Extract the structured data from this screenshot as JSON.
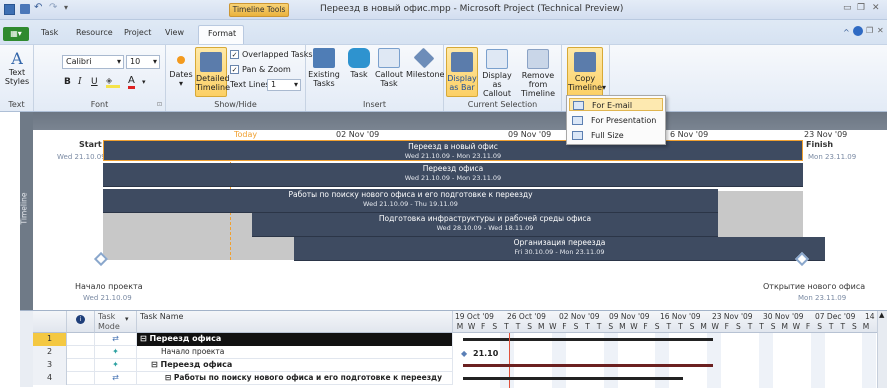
{
  "window": {
    "title": "Переезд в новый офис.mpp - Microsoft Project (Technical Preview)",
    "context_tab": "Timeline Tools"
  },
  "tabs": [
    "Task",
    "Resource",
    "Project",
    "View",
    "Format"
  ],
  "file_tab": "",
  "ribbon": {
    "text_styles": "Text\nStyles",
    "text_styles_l1": "Text",
    "text_styles_l2": "Styles",
    "font_name": "Calibri",
    "font_size": "10",
    "bold": "B",
    "italic": "I",
    "underline": "U",
    "group_text": "Text",
    "group_font": "Font",
    "dates": "Dates",
    "detailed_l1": "Detailed",
    "detailed_l2": "Timeline",
    "overlapped": "Overlapped Tasks",
    "pan_zoom": "Pan & Zoom",
    "text_lines_label": "Text Lines:",
    "text_lines_value": "1",
    "group_showhide": "Show/Hide",
    "existing_l1": "Existing",
    "existing_l2": "Tasks",
    "task": "Task",
    "callout_l1": "Callout",
    "callout_l2": "Task",
    "milestone": "Milestone",
    "group_insert": "Insert",
    "display_bar_l1": "Display",
    "display_bar_l2": "as Bar",
    "display_callout_l1": "Display",
    "display_callout_l2": "as Callout",
    "remove_l1": "Remove from",
    "remove_l2": "Timeline",
    "group_current": "Current Selection",
    "copy_l1": "Copy",
    "copy_l2": "Timeline"
  },
  "menu": {
    "items": [
      "For E-mail",
      "For Presentation",
      "Full Size"
    ]
  },
  "timeline": {
    "side_label": "Timeline",
    "today": "Today",
    "ticks": [
      "02 Nov '09",
      "09 Nov '09",
      "16 Nov '09",
      "23 Nov '09"
    ],
    "tick_partial": "6 Nov '09",
    "start_label": "Start",
    "start_date": "Wed 21.10.09",
    "finish_label": "Finish",
    "finish_date": "Mon 23.11.09",
    "bars": [
      {
        "name": "Переезд в новый офис",
        "dates": "Wed 21.10.09 - Mon 23.11.09"
      },
      {
        "name": "Переезд офиса",
        "dates": "Wed 21.10.09 - Mon 23.11.09"
      },
      {
        "name": "Работы по поиску нового офиса и его подготовке к переезду",
        "dates": "Wed 21.10.09 - Thu 19.11.09"
      },
      {
        "name": "Подготовка инфраструктуры и рабочей среды офиса",
        "dates": "Wed 28.10.09 - Wed 18.11.09"
      },
      {
        "name": "Организация переезда",
        "dates": "Fri 30.10.09 - Mon 23.11.09"
      }
    ],
    "milestones": [
      {
        "name": "Начало проекта",
        "date": "Wed 21.10.09"
      },
      {
        "name": "Открытие нового офиса",
        "date": "Mon 23.11.09"
      }
    ]
  },
  "grid": {
    "col_task_mode_l1": "Task",
    "col_task_mode_l2": "Mode",
    "col_task_name": "Task Name",
    "rows": [
      {
        "id": "1",
        "name": "Переезд офиса"
      },
      {
        "id": "2",
        "name": "Начало проекта"
      },
      {
        "id": "3",
        "name": "Переезд офиса"
      },
      {
        "id": "4",
        "name": "Работы по поиску нового офиса и его подготовке к переезду"
      }
    ],
    "gantt_weeks": [
      "19 Oct '09",
      "26 Oct '09",
      "02 Nov '09",
      "09 Nov '09",
      "16 Nov '09",
      "23 Nov '09",
      "30 Nov '09",
      "07 Dec '09",
      "14"
    ],
    "gantt_days": [
      "M",
      "W",
      "F",
      "S",
      "T",
      "T",
      "S",
      "M",
      "W",
      "F",
      "S",
      "T",
      "T",
      "S",
      "M",
      "W",
      "F",
      "S",
      "T",
      "T",
      "S",
      "M",
      "W",
      "F",
      "S",
      "T",
      "T",
      "S",
      "M",
      "W",
      "F",
      "S",
      "T",
      "T",
      "S",
      "M"
    ],
    "milestone_label": "21.10"
  },
  "colors": {
    "bar": "#3e4b61",
    "accent": "#f0a030",
    "ribbon_highlight": "#fcd065"
  }
}
